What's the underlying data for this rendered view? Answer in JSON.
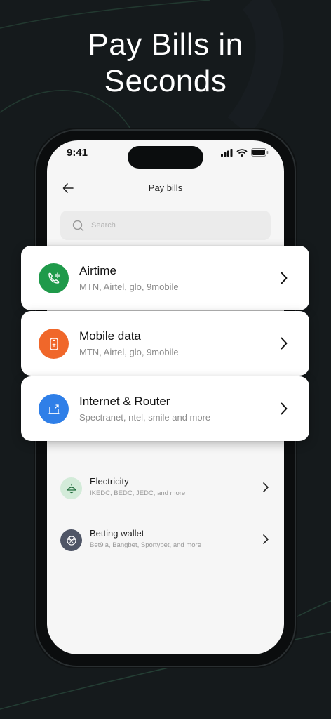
{
  "headline": {
    "line1": "Pay Bills in",
    "line2": "Seconds"
  },
  "status_bar": {
    "time": "9:41"
  },
  "header": {
    "title": "Pay bills"
  },
  "search": {
    "placeholder": "Search"
  },
  "featured_items": [
    {
      "label": "Airtime",
      "sub": "MTN, Airtel, glo, 9mobile",
      "icon": "phone-call-icon",
      "color": "#1f9a4a"
    },
    {
      "label": "Mobile data",
      "sub": "MTN, Airtel, glo, 9mobile",
      "icon": "mobile-wifi-icon",
      "color": "#f0672a"
    },
    {
      "label": "Internet & Router",
      "sub": "Spectranet, ntel, smile and more",
      "icon": "router-icon",
      "color": "#2f7fe8"
    }
  ],
  "list_items": [
    {
      "label": "Electricity",
      "sub": "IKEDC, BEDC, JEDC, and more",
      "icon": "bulb-icon",
      "color": "#cfe8d5"
    },
    {
      "label": "Betting wallet",
      "sub": "Bet9ja, Bangbet, Sportybet, and more",
      "icon": "ball-icon",
      "color": "#4f5566"
    }
  ],
  "colors": {
    "background": "#151a1c",
    "screen": "#f6f6f6",
    "accent_line": "#1f5a3e"
  }
}
